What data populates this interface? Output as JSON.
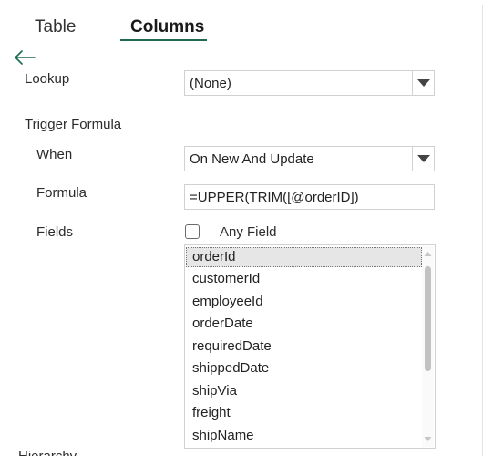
{
  "tabs": {
    "table_label": "Table",
    "columns_label": "Columns",
    "active": "Columns"
  },
  "colors": {
    "accent": "#1f6b4e",
    "selected_bg": "#e6e6e6"
  },
  "icons": {
    "back": "arrow-left-icon",
    "dropdown": "chevron-down-icon",
    "scroll_up": "scroll-up-icon",
    "scroll_down": "scroll-down-icon"
  },
  "lookup": {
    "label": "Lookup",
    "value": "(None)"
  },
  "trigger": {
    "section_label": "Trigger Formula",
    "when_label": "When",
    "when_value": "On New And Update",
    "formula_label": "Formula",
    "formula_value": "=UPPER(TRIM([@orderID])",
    "fields_label": "Fields",
    "any_field_label": "Any Field",
    "any_field_checked": false
  },
  "fields_list": {
    "items": [
      "orderId",
      "customerId",
      "employeeId",
      "orderDate",
      "requiredDate",
      "shippedDate",
      "shipVia",
      "freight",
      "shipName"
    ],
    "selected": "orderId"
  },
  "next_section_label": "Hierarchy"
}
